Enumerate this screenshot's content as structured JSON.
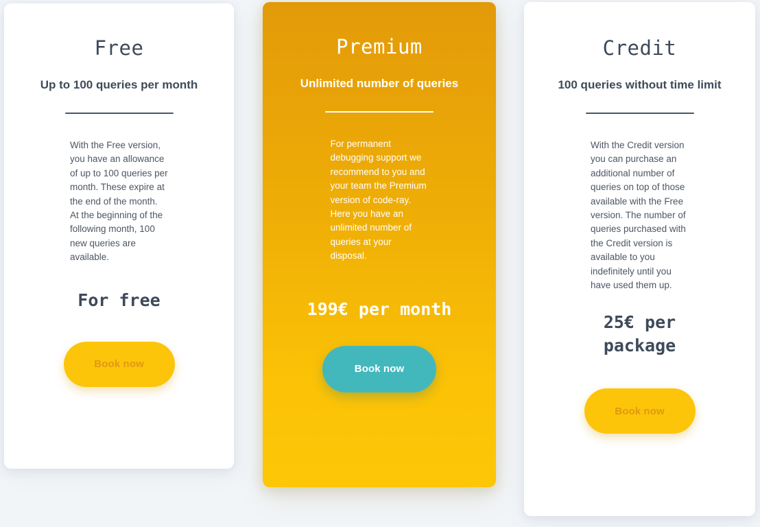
{
  "page": {
    "background_color": "#f2f5f8",
    "title": "Pricing plans"
  },
  "colors": {
    "card_white": "#ffffff",
    "premium_gradient_top": "#e39a09",
    "premium_gradient_bottom": "#fdc707",
    "text_slate": "#3e4a5a",
    "body_text": "#4c5663",
    "button_yellow": "#fcc50a",
    "button_yellow_text": "#e0990f",
    "button_teal": "#42b8bd",
    "button_teal_text": "#ffffff",
    "divider_slate": "#4a5568",
    "divider_white": "#ffffff"
  },
  "plans": [
    {
      "id": "free",
      "title": "Free",
      "subtitle": "Up to 100 queries per month",
      "description": "With  the Free version, you have an allowance of up to 100 queries per month. These expire at the end of the month. At the beginning of the following month, 100 new queries are available.",
      "price": "For free",
      "button_label": "Book now",
      "button_style": "yellow",
      "featured": false
    },
    {
      "id": "premium",
      "title": "Premium",
      "subtitle": "Unlimited number of queries",
      "description": "For permanent debugging support we recommend to you and your team the Premium version of code-ray. Here you have an unlimited number of queries at your disposal.",
      "price": "199€ per month",
      "button_label": "Book now",
      "button_style": "teal",
      "featured": true
    },
    {
      "id": "credit",
      "title": "Credit",
      "subtitle": "100 queries without time limit",
      "description": "With the Credit version you can purchase an additional number of queries on top of those available with the Free version. The number of queries purchased with the Credit version is available to you indefinitely until you have used them up.",
      "price": "25€ per package",
      "button_label": "Book now",
      "button_style": "yellow",
      "featured": false
    }
  ]
}
